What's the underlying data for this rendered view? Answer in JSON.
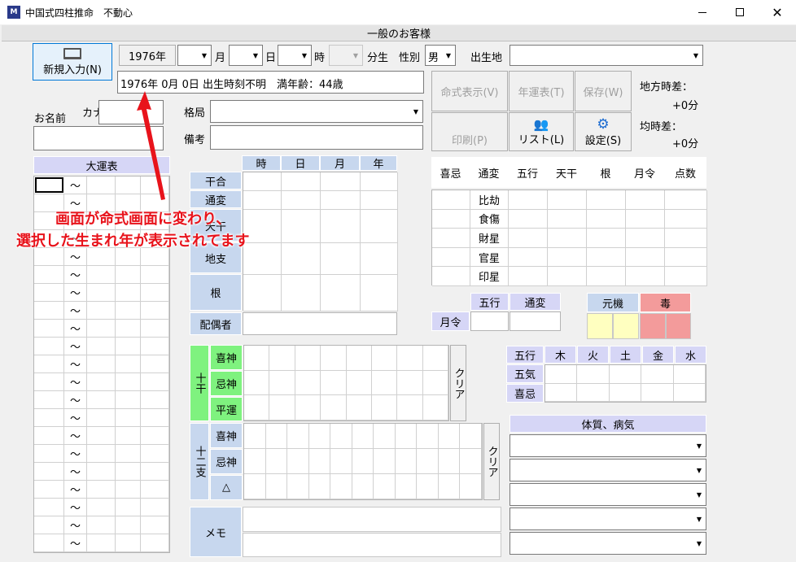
{
  "window": {
    "title": "中国式四柱推命　不動心",
    "icon": "app-logo-icon"
  },
  "banner": "一般のお客様",
  "buttons": {
    "new_entry": "新規入力(N)",
    "meishiki": "命式表示(V)",
    "nenunhyo": "年運表(T)",
    "save": "保存(W)",
    "print": "印刷(P)",
    "list": "リスト(L)",
    "settings": "設定(S)",
    "clear": "クリア"
  },
  "birth": {
    "year_button": "1976年",
    "year_unit": "年",
    "month_unit": "月",
    "day_unit": "日",
    "hour_unit": "時",
    "minute_unit": "分生",
    "gender_label": "性別",
    "gender_value": "男",
    "birthplace_label": "出生地"
  },
  "summary": "1976年 0月 0日 出生時刻不明　満年齢：44歳",
  "name": {
    "label": "お名前",
    "kana_label": "カナ"
  },
  "kakukyoku_label": "格局",
  "biko_label": "備考",
  "time_diff": {
    "local_label": "地方時差：",
    "local_value": "+0分",
    "mean_label": "均時差：",
    "mean_value": "+0分"
  },
  "daiun": {
    "title": "大運表",
    "tilde": "～",
    "rows": 21
  },
  "pillars": {
    "cols": [
      "時",
      "日",
      "月",
      "年"
    ],
    "rows": [
      "干合",
      "通変",
      "天干",
      "地支",
      "根"
    ],
    "haigusha": "配偶者"
  },
  "right_table": {
    "headers": [
      "喜忌",
      "通変",
      "五行",
      "天干",
      "根",
      "月令",
      "点数"
    ],
    "tsuhen": [
      "比劫",
      "食傷",
      "財星",
      "官星",
      "印星"
    ]
  },
  "gekirei": {
    "label": "月令",
    "gogyo": "五行",
    "tsuhen": "通変"
  },
  "genki": {
    "label": "元機",
    "doku": "毒"
  },
  "jikkan": {
    "label": "十干",
    "rows": [
      "喜神",
      "忌神",
      "平運"
    ]
  },
  "junishi": {
    "label": "十二支",
    "rows": [
      "喜神",
      "忌神",
      "△"
    ]
  },
  "memo": "メモ",
  "gogyo_table": {
    "header": "五行",
    "elements": [
      "木",
      "火",
      "土",
      "金",
      "水"
    ],
    "rows": [
      "五気",
      "喜忌"
    ]
  },
  "taishitsu": "体質、病気",
  "annotation": {
    "line1": "画面が命式画面に変わり、",
    "line2": "選択した生まれ年が表示されてます"
  },
  "colors": {
    "header_blue": "#c7d7ee",
    "lavender": "#d6d6f6",
    "green": "#7ff27f",
    "yellow": "#ffffc0",
    "pink": "#f39b9b",
    "red": "#e8131b"
  }
}
